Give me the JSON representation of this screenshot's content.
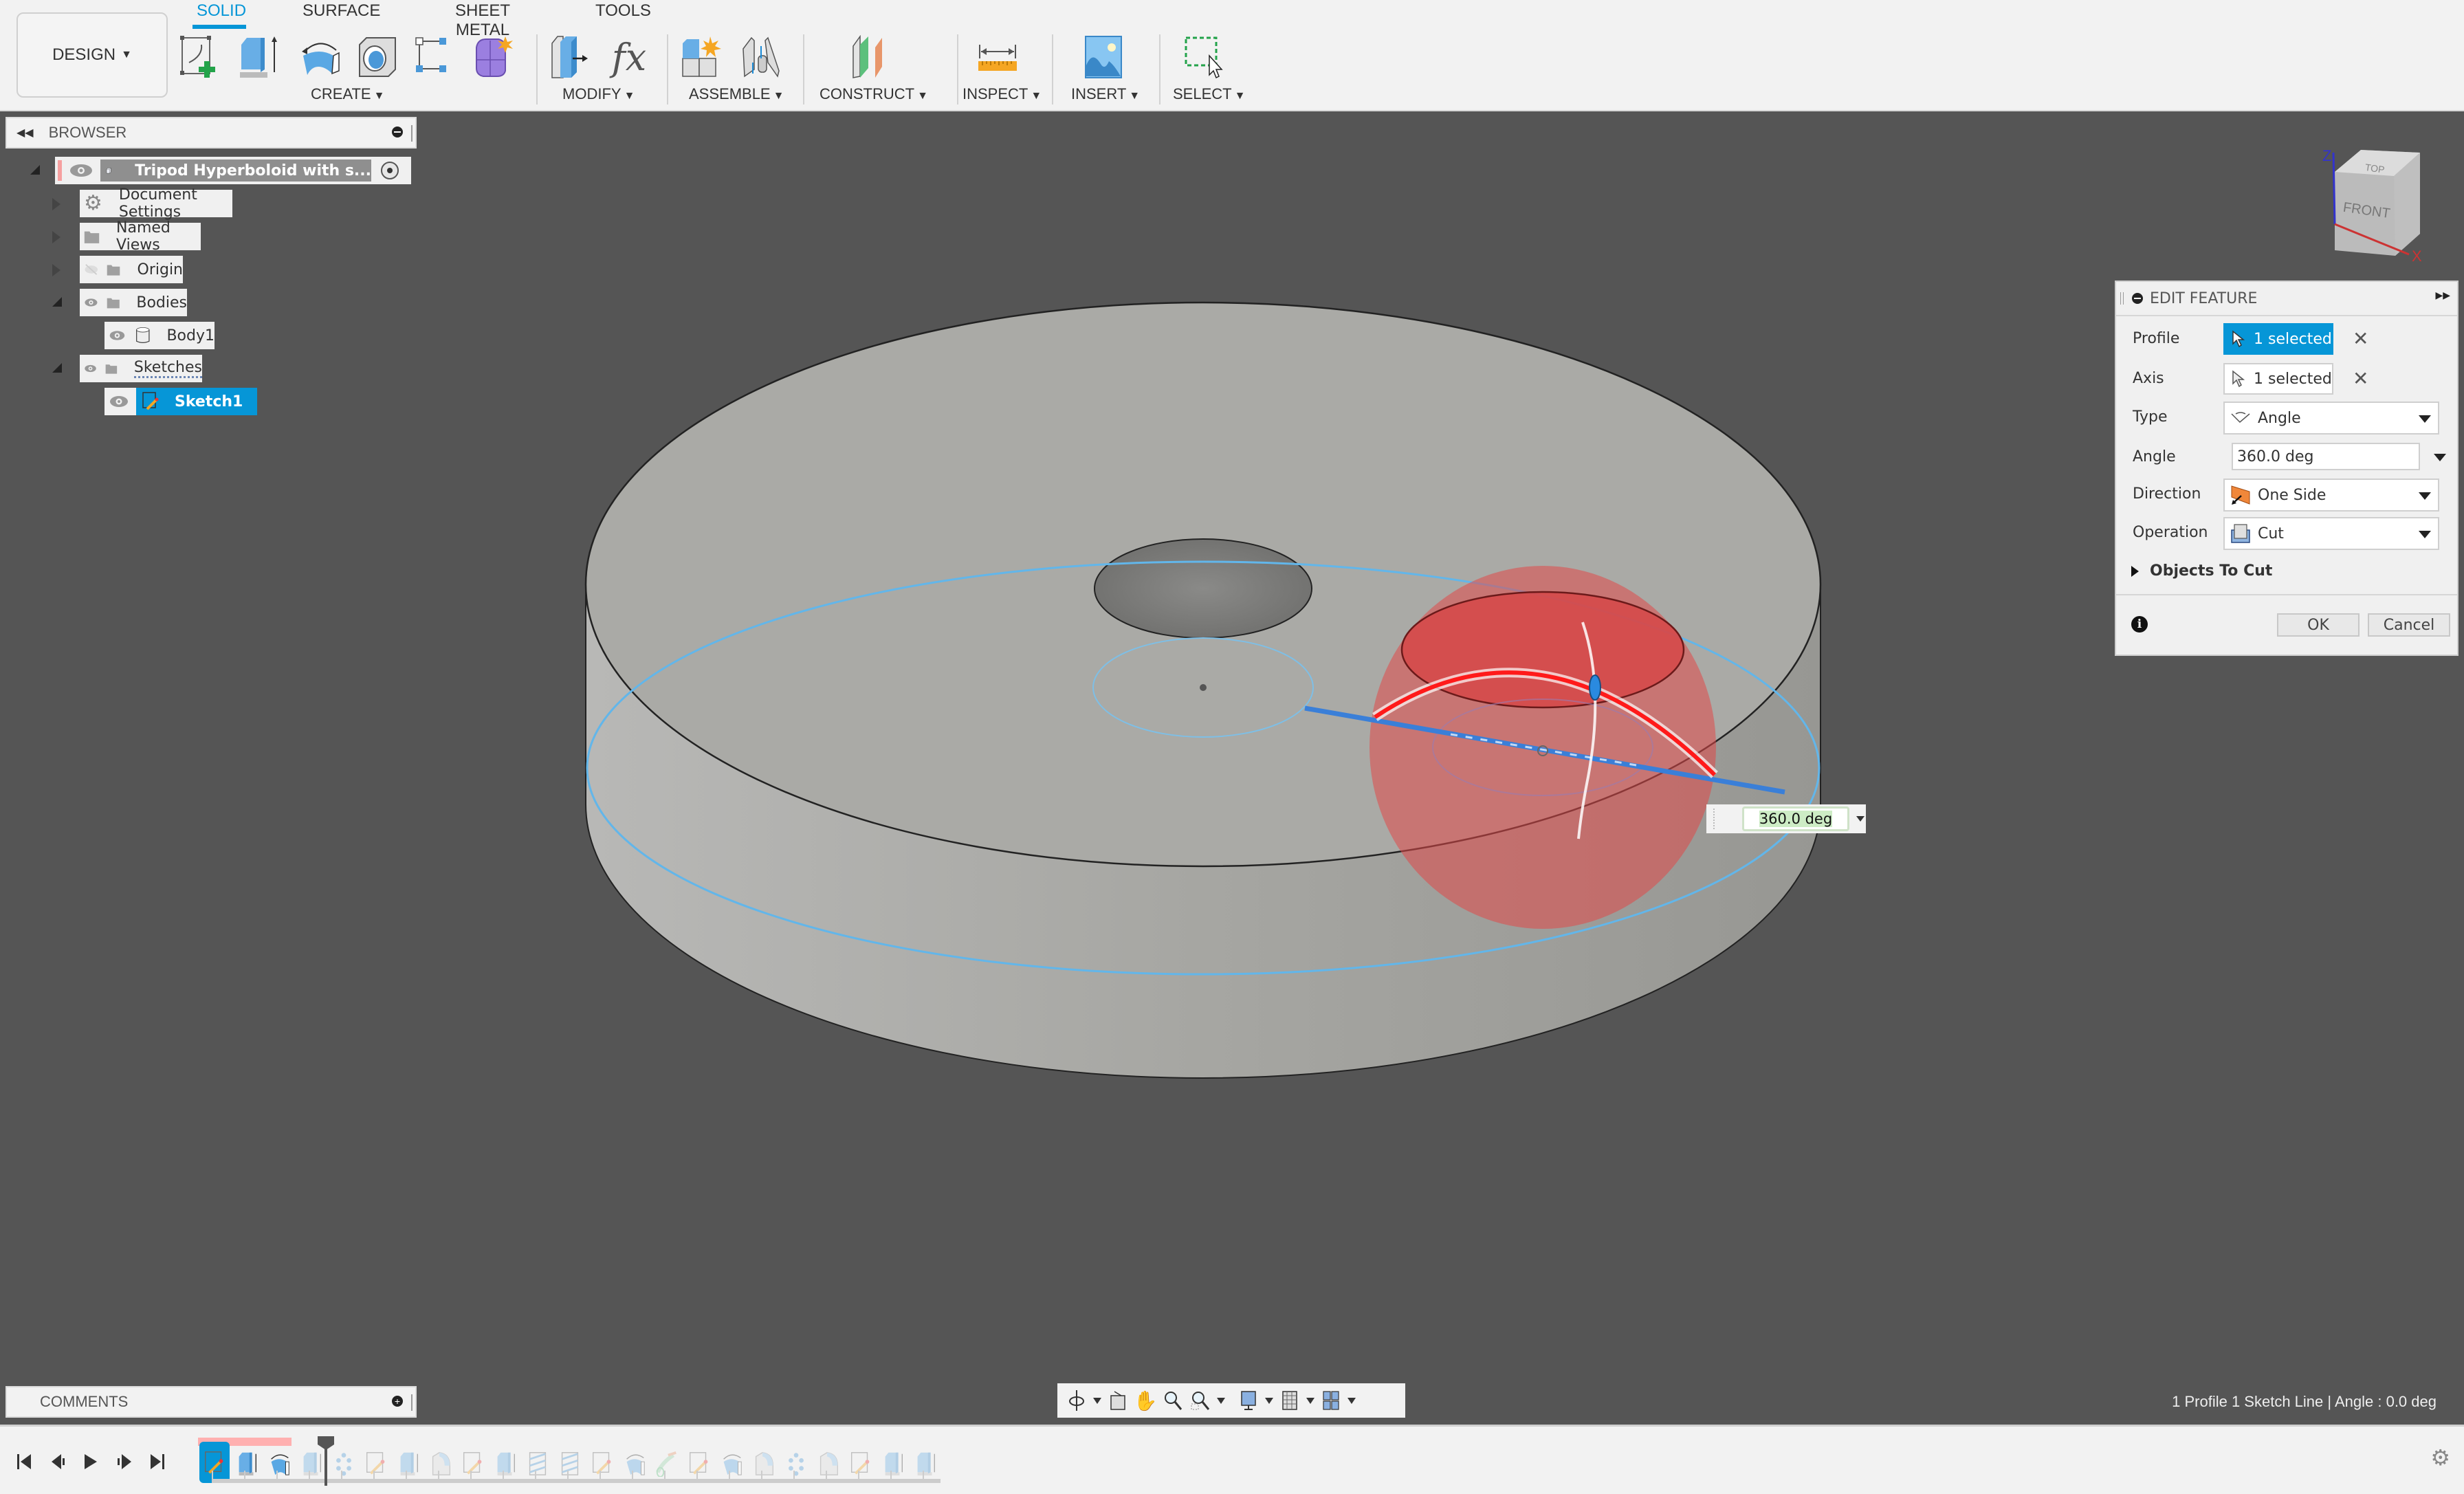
{
  "toolbar": {
    "workspace_button": "DESIGN",
    "tabs": [
      {
        "label": "SOLID",
        "active": true
      },
      {
        "label": "SURFACE",
        "active": false
      },
      {
        "label": "SHEET METAL",
        "active": false
      },
      {
        "label": "TOOLS",
        "active": false
      }
    ],
    "groups": {
      "create": "CREATE",
      "modify": "MODIFY",
      "assemble": "ASSEMBLE",
      "construct": "CONSTRUCT",
      "inspect": "INSPECT",
      "insert": "INSERT",
      "select": "SELECT"
    },
    "tools": {
      "create": [
        "create-sketch-icon",
        "extrude-icon",
        "revolve-icon",
        "hole-icon",
        "pattern-icon",
        "create-form-icon"
      ],
      "modify": [
        "press-pull-icon",
        "parameters-icon"
      ],
      "assemble": [
        "new-component-icon",
        "joint-icon"
      ],
      "construct": [
        "offset-plane-icon"
      ],
      "inspect": [
        "measure-icon"
      ],
      "insert": [
        "insert-image-icon"
      ],
      "select": [
        "window-select-icon"
      ]
    },
    "parameters_glyph": "fx"
  },
  "browser": {
    "title": "BROWSER",
    "root": "Tripod Hyperboloid with s...",
    "items": [
      {
        "label": "Document Settings",
        "icon": "gear-icon"
      },
      {
        "label": "Named Views",
        "icon": "folder-icon"
      },
      {
        "label": "Origin",
        "icon": "folder-icon",
        "visibility": "hidden"
      },
      {
        "label": "Bodies",
        "icon": "folder-icon",
        "visibility": "visible"
      },
      {
        "label": "Body1",
        "icon": "body-icon",
        "visibility": "visible"
      },
      {
        "label": "Sketches",
        "icon": "folder-icon",
        "visibility": "visible"
      },
      {
        "label": "Sketch1",
        "icon": "sketch-icon",
        "visibility": "visible",
        "selected": true
      }
    ]
  },
  "comments": {
    "title": "COMMENTS"
  },
  "viewcube": {
    "front": "FRONT",
    "top": "TOP",
    "axis_z": "Z",
    "axis_x": "X"
  },
  "edit_feature": {
    "title": "EDIT FEATURE",
    "profile_label": "Profile",
    "profile_value": "1 selected",
    "axis_label": "Axis",
    "axis_value": "1 selected",
    "type_label": "Type",
    "type_value": "Angle",
    "angle_label": "Angle",
    "angle_value": "360.0 deg",
    "direction_label": "Direction",
    "direction_value": "One Side",
    "operation_label": "Operation",
    "operation_value": "Cut",
    "objects_to_cut": "Objects To Cut",
    "ok": "OK",
    "cancel": "Cancel"
  },
  "manipulator": {
    "angle_value": "360.0 deg"
  },
  "status": "1 Profile 1 Sketch Line | Angle : 0.0 deg",
  "colors": {
    "accent": "#0696d7",
    "cut_body": "#e04848",
    "sketch_line": "#5aaee8",
    "axis_line": "#3a7fd8",
    "body": "#a8a8a4"
  },
  "timeline": {
    "items": [
      {
        "type": "sketch",
        "state": "current"
      },
      {
        "type": "extrude",
        "state": "active"
      },
      {
        "type": "revolve",
        "state": "active"
      },
      {
        "type": "extrude",
        "state": "suppressed"
      },
      {
        "type": "pattern",
        "state": "suppressed"
      },
      {
        "type": "sketch",
        "state": "suppressed"
      },
      {
        "type": "extrude",
        "state": "suppressed"
      },
      {
        "type": "fillet",
        "state": "suppressed"
      },
      {
        "type": "sketch",
        "state": "suppressed"
      },
      {
        "type": "extrude",
        "state": "suppressed"
      },
      {
        "type": "thread",
        "state": "suppressed"
      },
      {
        "type": "thread",
        "state": "suppressed"
      },
      {
        "type": "sketch",
        "state": "suppressed"
      },
      {
        "type": "revolve",
        "state": "suppressed"
      },
      {
        "type": "sweep",
        "state": "suppressed"
      },
      {
        "type": "sketch",
        "state": "suppressed"
      },
      {
        "type": "revolve",
        "state": "suppressed"
      },
      {
        "type": "fillet",
        "state": "suppressed"
      },
      {
        "type": "pattern",
        "state": "suppressed"
      },
      {
        "type": "fillet",
        "state": "suppressed"
      },
      {
        "type": "sketch",
        "state": "suppressed"
      },
      {
        "type": "extrude",
        "state": "suppressed"
      },
      {
        "type": "extrude",
        "state": "suppressed"
      }
    ],
    "controls": [
      "go-to-start",
      "step-back",
      "play",
      "step-forward",
      "go-to-end"
    ]
  }
}
